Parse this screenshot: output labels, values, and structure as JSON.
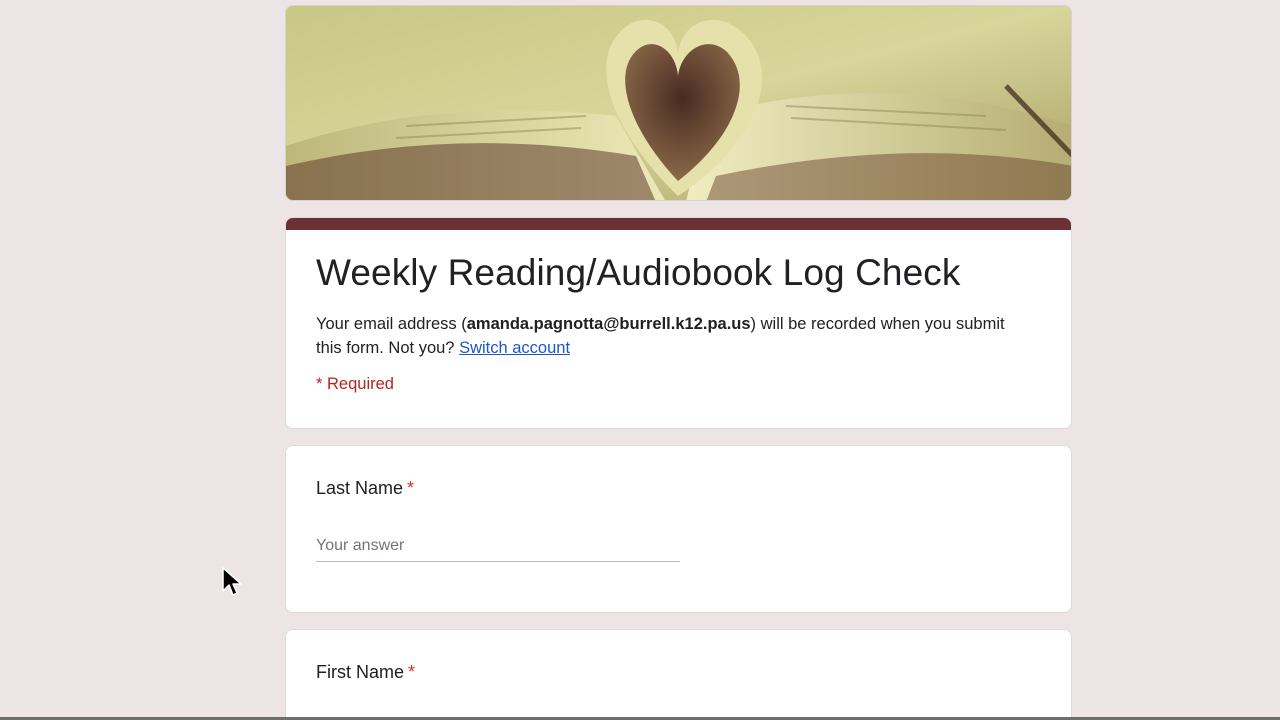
{
  "form": {
    "title": "Weekly Reading/Audiobook Log Check",
    "email_prefix": "Your email address (",
    "email": "amanda.pagnotta@burrell.k12.pa.us",
    "email_suffix": ") will be recorded when you submit this form. Not you?",
    "switch_account": "Switch account",
    "required_note": "* Required",
    "accent_color": "#6b2f36"
  },
  "questions": [
    {
      "label": "Last Name",
      "required_mark": "*",
      "placeholder": "Your answer"
    },
    {
      "label": "First Name",
      "required_mark": "*"
    }
  ]
}
